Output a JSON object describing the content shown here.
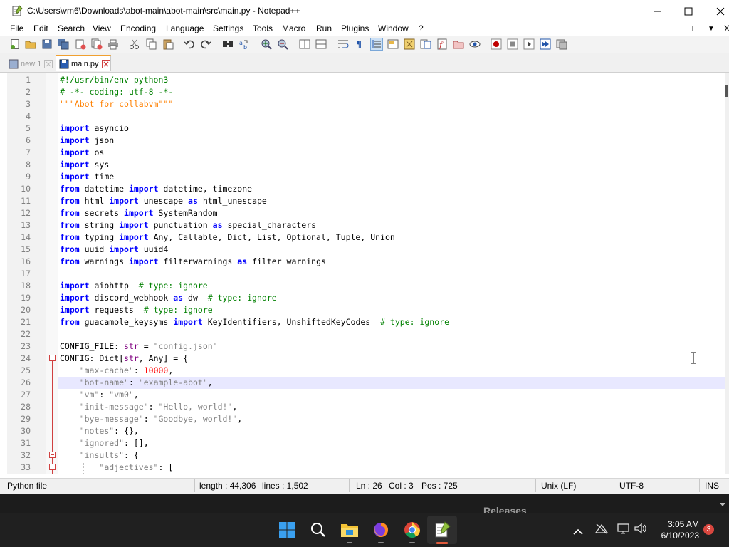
{
  "window": {
    "title": "C:\\Users\\vm6\\Downloads\\abot-main\\abot-main\\src\\main.py - Notepad++"
  },
  "menu": [
    "File",
    "Edit",
    "Search",
    "View",
    "Encoding",
    "Language",
    "Settings",
    "Tools",
    "Macro",
    "Run",
    "Plugins",
    "Window",
    "?"
  ],
  "menu_right": {
    "plus": "+",
    "down": "▼",
    "close": "X"
  },
  "tabs": [
    {
      "label": "new 1",
      "active": false
    },
    {
      "label": "main.py",
      "active": true
    }
  ],
  "editor": {
    "language": "Python",
    "current_line": 26,
    "lines": [
      {
        "n": "1",
        "text": "#!/usr/bin/env python3"
      },
      {
        "n": "2",
        "text": "# -*- coding: utf-8 -*-"
      },
      {
        "n": "3",
        "text": "\"\"\"Abot for collabvm\"\"\""
      },
      {
        "n": "4",
        "text": ""
      },
      {
        "n": "5",
        "text": "import asyncio"
      },
      {
        "n": "6",
        "text": "import json"
      },
      {
        "n": "7",
        "text": "import os"
      },
      {
        "n": "8",
        "text": "import sys"
      },
      {
        "n": "9",
        "text": "import time"
      },
      {
        "n": "10",
        "text": "from datetime import datetime, timezone"
      },
      {
        "n": "11",
        "text": "from html import unescape as html_unescape"
      },
      {
        "n": "12",
        "text": "from secrets import SystemRandom"
      },
      {
        "n": "13",
        "text": "from string import punctuation as special_characters"
      },
      {
        "n": "14",
        "text": "from typing import Any, Callable, Dict, List, Optional, Tuple, Union"
      },
      {
        "n": "15",
        "text": "from uuid import uuid4"
      },
      {
        "n": "16",
        "text": "from warnings import filterwarnings as filter_warnings"
      },
      {
        "n": "17",
        "text": ""
      },
      {
        "n": "18",
        "text": "import aiohttp  # type: ignore"
      },
      {
        "n": "19",
        "text": "import discord_webhook as dw  # type: ignore"
      },
      {
        "n": "20",
        "text": "import requests  # type: ignore"
      },
      {
        "n": "21",
        "text": "from guacamole_keysyms import KeyIdentifiers, UnshiftedKeyCodes  # type: ignore"
      },
      {
        "n": "22",
        "text": ""
      },
      {
        "n": "23",
        "text": "CONFIG_FILE: str = \"config.json\""
      },
      {
        "n": "24",
        "text": "CONFIG: Dict[str, Any] = {"
      },
      {
        "n": "25",
        "text": "    \"max-cache\": 10000,"
      },
      {
        "n": "26",
        "text": "    \"bot-name\": \"example-abot\","
      },
      {
        "n": "27",
        "text": "    \"vm\": \"vm0\","
      },
      {
        "n": "28",
        "text": "    \"init-message\": \"Hello, world!\","
      },
      {
        "n": "29",
        "text": "    \"bye-message\": \"Goodbye, world!\","
      },
      {
        "n": "30",
        "text": "    \"notes\": {},"
      },
      {
        "n": "31",
        "text": "    \"ignored\": [],"
      },
      {
        "n": "32",
        "text": "    \"insults\": {"
      },
      {
        "n": "33",
        "text": "        \"adjectives\": ["
      }
    ]
  },
  "status": {
    "file_type": "Python file",
    "length": "length : 44,306",
    "lines": "lines : 1,502",
    "ln": "Ln : 26",
    "col": "Col : 3",
    "pos": "Pos : 725",
    "eol": "Unix (LF)",
    "encoding": "UTF-8",
    "mode": "INS"
  },
  "background": {
    "partial_text": "Releases"
  },
  "taskbar": {
    "time": "3:05 AM",
    "date": "6/10/2023",
    "notification_count": "3"
  },
  "colors": {
    "keyword": "#0000ff",
    "comment": "#008000",
    "string": "#808080",
    "docstring": "#ff8000",
    "number": "#ff0000",
    "current_line": "#e8e8ff"
  }
}
